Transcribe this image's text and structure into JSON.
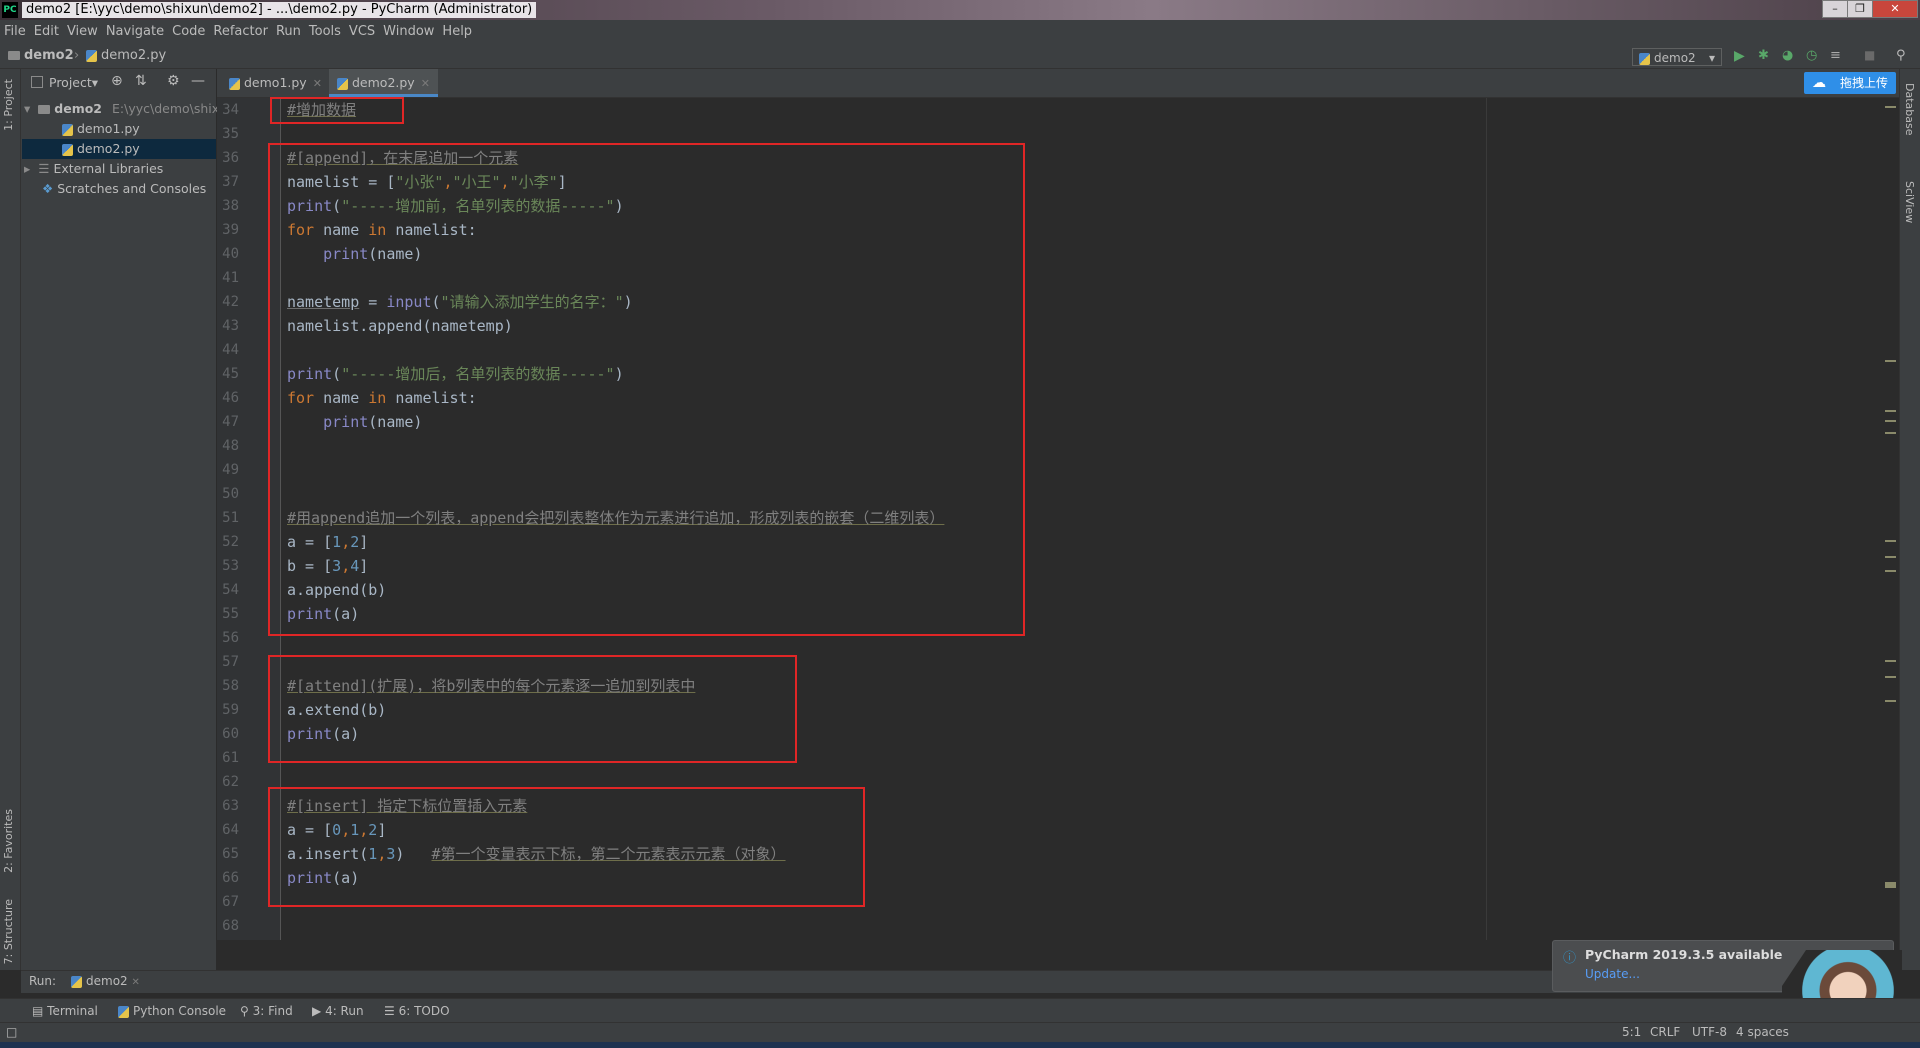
{
  "window": {
    "title": "demo2 [E:\\yyc\\demo\\shixun\\demo2] - ...\\demo2.py - PyCharm (Administrator)",
    "app_icon": "PC"
  },
  "menu": [
    "File",
    "Edit",
    "View",
    "Navigate",
    "Code",
    "Refactor",
    "Run",
    "Tools",
    "VCS",
    "Window",
    "Help"
  ],
  "breadcrumb": {
    "project": "demo2",
    "file": "demo2.py"
  },
  "run_config": "demo2",
  "project_panel": {
    "header": "Project",
    "root": {
      "name": "demo2",
      "path": "E:\\yyc\\demo\\shixu"
    },
    "files": [
      "demo1.py",
      "demo2.py"
    ],
    "selected": "demo2.py",
    "external": "External Libraries",
    "scratches": "Scratches and Consoles"
  },
  "left_tabs": {
    "project": "1: Project",
    "favorites": "2: Favorites",
    "structure": "7: Structure"
  },
  "right_tabs": {
    "database": "Database",
    "sciview": "SciView"
  },
  "tabs": [
    {
      "label": "demo1.py",
      "active": false
    },
    {
      "label": "demo2.py",
      "active": true
    }
  ],
  "upload_button": "拖拽上传",
  "code": {
    "line_numbers": [
      "34",
      "35",
      "36",
      "37",
      "38",
      "39",
      "40",
      "41",
      "42",
      "43",
      "44",
      "45",
      "46",
      "47",
      "48",
      "49",
      "50",
      "51",
      "52",
      "53",
      "54",
      "55",
      "56",
      "57",
      "58",
      "59",
      "60",
      "61",
      "62",
      "63",
      "64",
      "65",
      "66",
      "67",
      "68"
    ],
    "comment_34": "#增加数据",
    "comment_36": "#[append]，在末尾追加一个元素",
    "l37_var": "namelist",
    "l37_s1": "\"小张\"",
    "l37_s2": "\"小王\"",
    "l37_s3": "\"小李\"",
    "l38_str": "\"-----增加前，名单列表的数据-----\"",
    "l39_for": "for",
    "l39_name": "name",
    "l39_in": "in",
    "l39_list": "namelist:",
    "print": "print",
    "l40_arg": "(name)",
    "l42_var": "nametemp",
    "l42_func": "input",
    "l42_str": "\"请输入添加学生的名字：\"",
    "l43": "namelist.append(nametemp)",
    "l45_str": "\"-----增加后，名单列表的数据-----\"",
    "comment_51": "#用append追加一个列表，append会把列表整体作为元素进行追加，形成列表的嵌套（二维列表）",
    "l52_n1": "1",
    "l52_n2": "2",
    "l53_n1": "3",
    "l53_n2": "4",
    "l54": "a.append(b)",
    "l55_arg": "(a)",
    "comment_58": "#[attend](扩展)，将b列表中的每个元素逐一追加到列表中",
    "l59": "a.extend(b)",
    "comment_63": "#[insert] 指定下标位置插入元素",
    "l64_n0": "0",
    "l64_n1": "1",
    "l64_n2": "2",
    "l65_pre": "a.insert(",
    "l65_n1": "1",
    "l65_n2": "3",
    "comment_65": "#第一个变量表示下标，第二个元素表示元素（对象）"
  },
  "run_bar": {
    "label": "Run:",
    "config": "demo2"
  },
  "bottom_tabs": [
    "Terminal",
    "Python Console",
    "3: Find",
    "4: Run",
    "6: TODO"
  ],
  "notification": {
    "title": "PyCharm 2019.3.5 available",
    "link": "Update..."
  },
  "status": {
    "position": "5:1",
    "line_sep": "CRLF",
    "encoding": "UTF-8",
    "indent": "4 spaces"
  },
  "colors": {
    "keyword": "#cc7832",
    "builtin": "#8888c6",
    "string": "#6a8759",
    "comment": "#808080",
    "number": "#6897bb",
    "highlight_box": "#e02626"
  }
}
